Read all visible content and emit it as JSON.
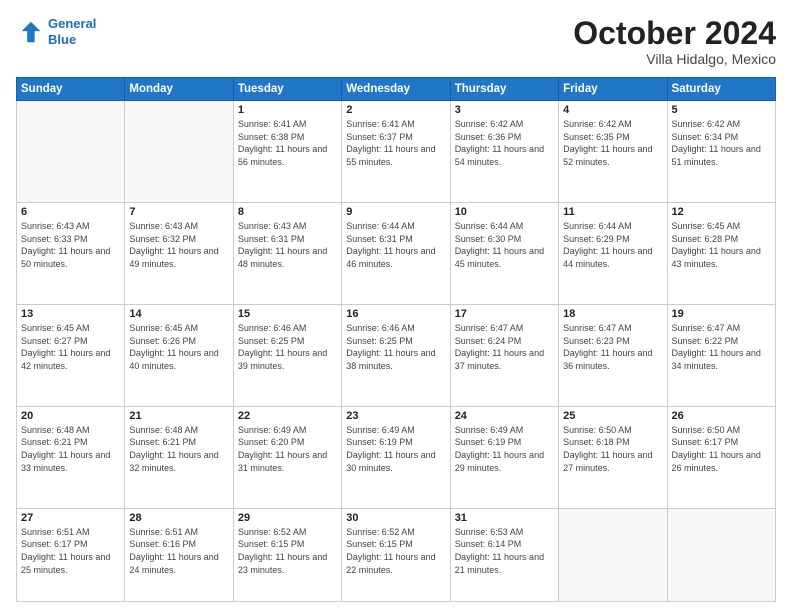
{
  "header": {
    "logo_line1": "General",
    "logo_line2": "Blue",
    "month": "October 2024",
    "location": "Villa Hidalgo, Mexico"
  },
  "days_of_week": [
    "Sunday",
    "Monday",
    "Tuesday",
    "Wednesday",
    "Thursday",
    "Friday",
    "Saturday"
  ],
  "weeks": [
    [
      {
        "day": "",
        "info": ""
      },
      {
        "day": "",
        "info": ""
      },
      {
        "day": "1",
        "info": "Sunrise: 6:41 AM\nSunset: 6:38 PM\nDaylight: 11 hours and 56 minutes."
      },
      {
        "day": "2",
        "info": "Sunrise: 6:41 AM\nSunset: 6:37 PM\nDaylight: 11 hours and 55 minutes."
      },
      {
        "day": "3",
        "info": "Sunrise: 6:42 AM\nSunset: 6:36 PM\nDaylight: 11 hours and 54 minutes."
      },
      {
        "day": "4",
        "info": "Sunrise: 6:42 AM\nSunset: 6:35 PM\nDaylight: 11 hours and 52 minutes."
      },
      {
        "day": "5",
        "info": "Sunrise: 6:42 AM\nSunset: 6:34 PM\nDaylight: 11 hours and 51 minutes."
      }
    ],
    [
      {
        "day": "6",
        "info": "Sunrise: 6:43 AM\nSunset: 6:33 PM\nDaylight: 11 hours and 50 minutes."
      },
      {
        "day": "7",
        "info": "Sunrise: 6:43 AM\nSunset: 6:32 PM\nDaylight: 11 hours and 49 minutes."
      },
      {
        "day": "8",
        "info": "Sunrise: 6:43 AM\nSunset: 6:31 PM\nDaylight: 11 hours and 48 minutes."
      },
      {
        "day": "9",
        "info": "Sunrise: 6:44 AM\nSunset: 6:31 PM\nDaylight: 11 hours and 46 minutes."
      },
      {
        "day": "10",
        "info": "Sunrise: 6:44 AM\nSunset: 6:30 PM\nDaylight: 11 hours and 45 minutes."
      },
      {
        "day": "11",
        "info": "Sunrise: 6:44 AM\nSunset: 6:29 PM\nDaylight: 11 hours and 44 minutes."
      },
      {
        "day": "12",
        "info": "Sunrise: 6:45 AM\nSunset: 6:28 PM\nDaylight: 11 hours and 43 minutes."
      }
    ],
    [
      {
        "day": "13",
        "info": "Sunrise: 6:45 AM\nSunset: 6:27 PM\nDaylight: 11 hours and 42 minutes."
      },
      {
        "day": "14",
        "info": "Sunrise: 6:45 AM\nSunset: 6:26 PM\nDaylight: 11 hours and 40 minutes."
      },
      {
        "day": "15",
        "info": "Sunrise: 6:46 AM\nSunset: 6:25 PM\nDaylight: 11 hours and 39 minutes."
      },
      {
        "day": "16",
        "info": "Sunrise: 6:46 AM\nSunset: 6:25 PM\nDaylight: 11 hours and 38 minutes."
      },
      {
        "day": "17",
        "info": "Sunrise: 6:47 AM\nSunset: 6:24 PM\nDaylight: 11 hours and 37 minutes."
      },
      {
        "day": "18",
        "info": "Sunrise: 6:47 AM\nSunset: 6:23 PM\nDaylight: 11 hours and 36 minutes."
      },
      {
        "day": "19",
        "info": "Sunrise: 6:47 AM\nSunset: 6:22 PM\nDaylight: 11 hours and 34 minutes."
      }
    ],
    [
      {
        "day": "20",
        "info": "Sunrise: 6:48 AM\nSunset: 6:21 PM\nDaylight: 11 hours and 33 minutes."
      },
      {
        "day": "21",
        "info": "Sunrise: 6:48 AM\nSunset: 6:21 PM\nDaylight: 11 hours and 32 minutes."
      },
      {
        "day": "22",
        "info": "Sunrise: 6:49 AM\nSunset: 6:20 PM\nDaylight: 11 hours and 31 minutes."
      },
      {
        "day": "23",
        "info": "Sunrise: 6:49 AM\nSunset: 6:19 PM\nDaylight: 11 hours and 30 minutes."
      },
      {
        "day": "24",
        "info": "Sunrise: 6:49 AM\nSunset: 6:19 PM\nDaylight: 11 hours and 29 minutes."
      },
      {
        "day": "25",
        "info": "Sunrise: 6:50 AM\nSunset: 6:18 PM\nDaylight: 11 hours and 27 minutes."
      },
      {
        "day": "26",
        "info": "Sunrise: 6:50 AM\nSunset: 6:17 PM\nDaylight: 11 hours and 26 minutes."
      }
    ],
    [
      {
        "day": "27",
        "info": "Sunrise: 6:51 AM\nSunset: 6:17 PM\nDaylight: 11 hours and 25 minutes."
      },
      {
        "day": "28",
        "info": "Sunrise: 6:51 AM\nSunset: 6:16 PM\nDaylight: 11 hours and 24 minutes."
      },
      {
        "day": "29",
        "info": "Sunrise: 6:52 AM\nSunset: 6:15 PM\nDaylight: 11 hours and 23 minutes."
      },
      {
        "day": "30",
        "info": "Sunrise: 6:52 AM\nSunset: 6:15 PM\nDaylight: 11 hours and 22 minutes."
      },
      {
        "day": "31",
        "info": "Sunrise: 6:53 AM\nSunset: 6:14 PM\nDaylight: 11 hours and 21 minutes."
      },
      {
        "day": "",
        "info": ""
      },
      {
        "day": "",
        "info": ""
      }
    ]
  ]
}
